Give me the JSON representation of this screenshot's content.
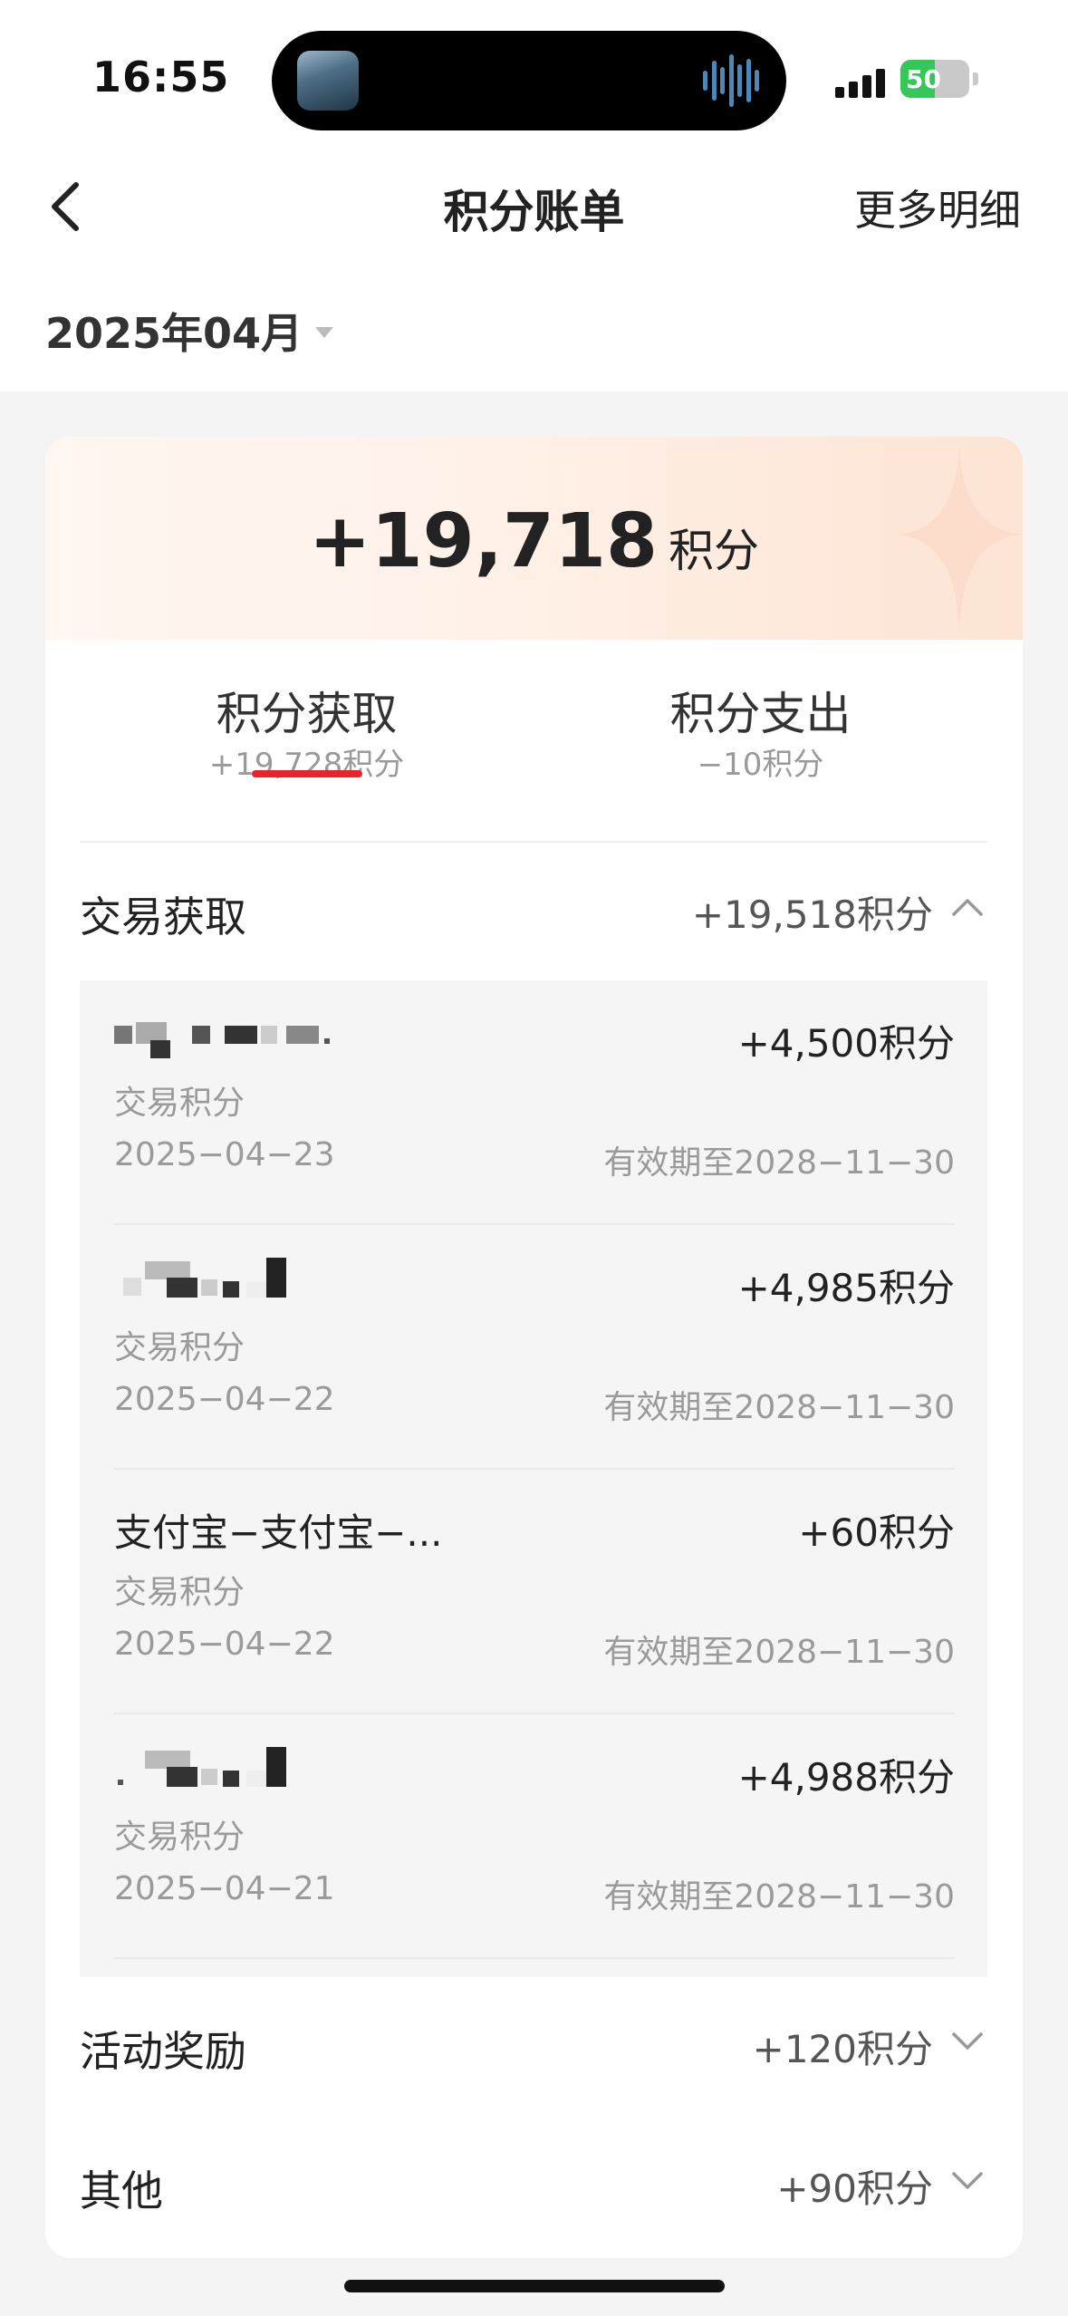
{
  "status_bar": {
    "time": "16:55",
    "battery": "50",
    "battery_level": 0.5
  },
  "header": {
    "title": "积分账单",
    "more": "更多明细"
  },
  "month": {
    "label": "2025年04月"
  },
  "summary": {
    "value": "+19,718",
    "unit": "积分"
  },
  "tabs": [
    {
      "label": "积分获取",
      "sub": "+19,728积分",
      "active": true
    },
    {
      "label": "积分支出",
      "sub": "−10积分",
      "active": false
    }
  ],
  "sections": {
    "trade": {
      "label": "交易获取",
      "amount": "+19,518积分",
      "expanded": true
    },
    "activity": {
      "label": "活动奖励",
      "amount": "+120积分",
      "expanded": false
    },
    "other": {
      "label": "其他",
      "amount": "+90积分",
      "expanded": false
    }
  },
  "transactions": [
    {
      "name": "",
      "redacted": true,
      "points": "+4,500积分",
      "type": "交易积分",
      "date": "2025−04−23",
      "expiry": "有效期至2028−11−30"
    },
    {
      "name": "",
      "redacted": true,
      "points": "+4,985积分",
      "type": "交易积分",
      "date": "2025−04−22",
      "expiry": "有效期至2028−11−30"
    },
    {
      "name": "支付宝−支付宝−...",
      "redacted": false,
      "points": "+60积分",
      "type": "交易积分",
      "date": "2025−04−22",
      "expiry": "有效期至2028−11−30"
    },
    {
      "name": "",
      "redacted": true,
      "points": "+4,988积分",
      "type": "交易积分",
      "date": "2025−04−21",
      "expiry": "有效期至2028−11−30"
    }
  ],
  "colors": {
    "accent": "#e8232d",
    "background": "#f4f4f4",
    "list_bg": "#f5f5f5",
    "muted": "#9a9a9a"
  },
  "icons": [
    "back-chevron-icon",
    "dropdown-caret-icon",
    "chevron-up-icon",
    "chevron-down-icon",
    "signal-icon",
    "battery-icon"
  ]
}
